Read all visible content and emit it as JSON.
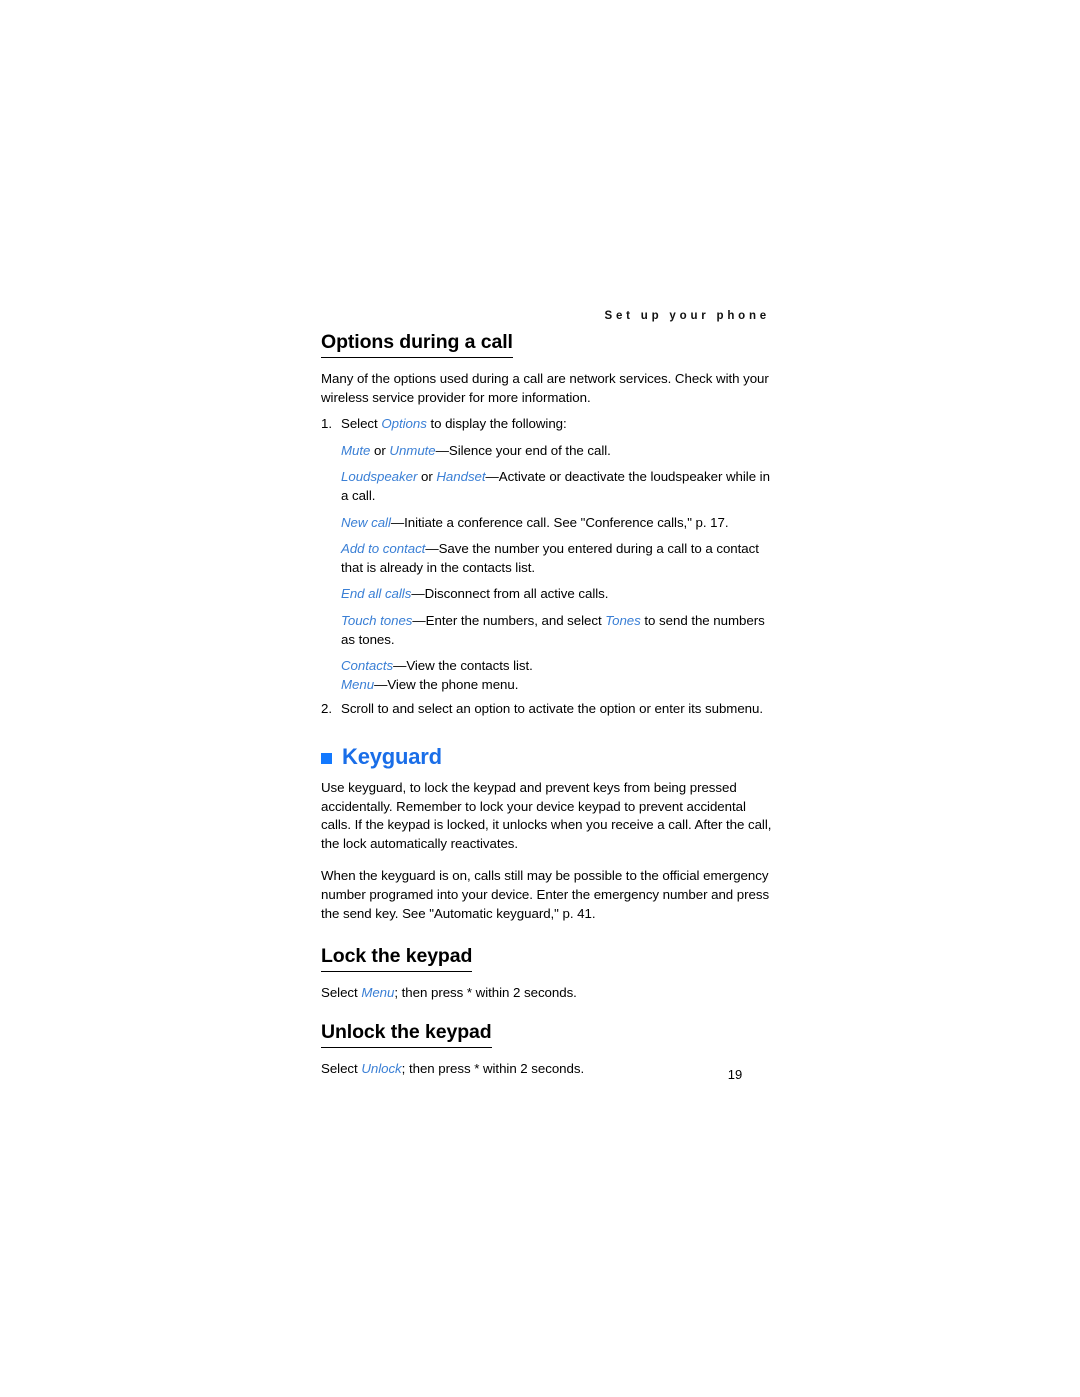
{
  "running_header": "Set up your phone",
  "folio": "19",
  "colors": {
    "heading_accent": "#1a6ee8",
    "bullet_square": "#1279ff",
    "inline_term": "#3a7fd5",
    "body_text": "#000000",
    "page_background": "#ffffff"
  },
  "sections": {
    "options_during_call": {
      "heading": "Options during a call",
      "intro": "Many of the options used during a call are network services. Check with your wireless service provider for more information.",
      "step1": {
        "number": "1.",
        "text_before": "Select ",
        "link": "Options",
        "text_after": " to display the following:"
      },
      "definitions": [
        {
          "term": "Mute",
          "conjunction": " or ",
          "term2": "Unmute",
          "dash": "—",
          "description": "Silence your end of the call."
        },
        {
          "term": "Loudspeaker",
          "conjunction": " or ",
          "term2": "Handset",
          "dash": "—",
          "description": "Activate or deactivate the loudspeaker while in a call."
        },
        {
          "term": "New call",
          "dash": "—",
          "description": "Initiate a conference call. See \"Conference calls,\" p. 17."
        },
        {
          "term": "Add to contact",
          "dash": "—",
          "description": "Save the number you entered during a call to a contact that is already in the contacts list."
        },
        {
          "term": "End all calls",
          "dash": "—",
          "description": "Disconnect from all active calls."
        },
        {
          "term": "Touch tones",
          "dash": "—",
          "description_before": "Enter the numbers, and select ",
          "inline_link": "Tones",
          "description_after": " to send the numbers as tones."
        },
        {
          "term": "Contacts",
          "dash": "—",
          "description": "View the contacts list."
        },
        {
          "term": "Menu",
          "dash": "—",
          "description": "View the phone menu."
        }
      ],
      "step2": {
        "number": "2.",
        "text": "Scroll to and select an option to activate the option or enter its submenu."
      }
    },
    "keyguard": {
      "heading": "Keyguard",
      "paragraph1": "Use keyguard, to lock the keypad and prevent keys from being pressed accidentally. Remember to lock your device keypad to prevent accidental calls. If the keypad is locked, it unlocks when you receive a call. After the call, the lock automatically reactivates.",
      "paragraph2": "When the keyguard is on, calls still may be possible to the official emergency number programed into your device. Enter the emergency number and press the send key. See \"Automatic keyguard,\" p. 41.",
      "lock": {
        "heading": "Lock the keypad",
        "text_before": "Select ",
        "link": "Menu",
        "text_after": "; then press * within 2 seconds."
      },
      "unlock": {
        "heading": "Unlock the keypad",
        "text_before": "Select ",
        "link": "Unlock",
        "text_after": "; then press * within 2 seconds."
      }
    }
  }
}
